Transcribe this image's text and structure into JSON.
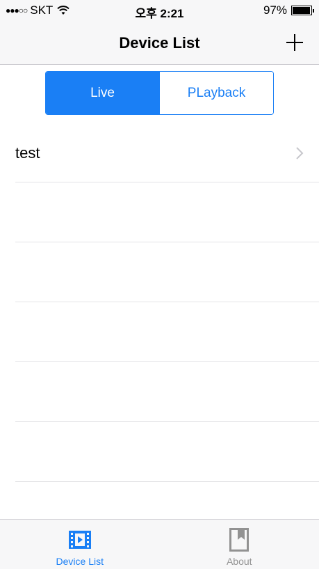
{
  "status_bar": {
    "signal": "●●●○○",
    "carrier": "SKT",
    "time": "오후 2:21",
    "battery": "97%",
    "battery_level": 0.97
  },
  "nav": {
    "title": "Device List",
    "add_icon": "plus-icon"
  },
  "segments": {
    "live": "Live",
    "playback": "PLayback",
    "selected": "live"
  },
  "devices": [
    {
      "label": "test",
      "icon": "chevron-right-icon"
    },
    {
      "label": ""
    },
    {
      "label": ""
    },
    {
      "label": ""
    },
    {
      "label": ""
    },
    {
      "label": ""
    }
  ],
  "tabs": [
    {
      "label": "Device List",
      "icon": "film-icon",
      "active": true
    },
    {
      "label": "About",
      "icon": "bookmark-icon",
      "active": false
    }
  ],
  "colors": {
    "accent": "#1a7ff5",
    "inactive": "#929292",
    "bar_background": "#f7f7f8",
    "separator": "#e3e3e6"
  }
}
